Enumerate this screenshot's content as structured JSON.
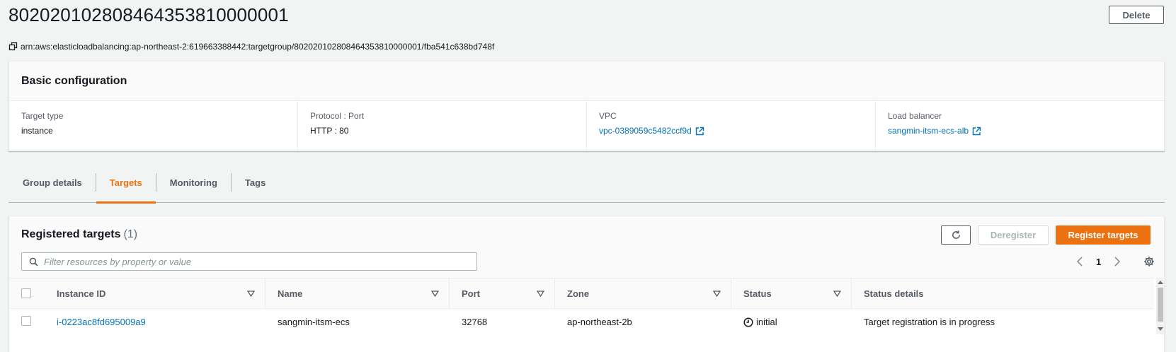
{
  "header": {
    "title": "802020102808464353810000001",
    "delete_label": "Delete",
    "arn": "arn:aws:elasticloadbalancing:ap-northeast-2:619663388442:targetgroup/802020102808464353810000001/fba541c638bd748f"
  },
  "basic_config": {
    "title": "Basic configuration",
    "fields": [
      {
        "label": "Target type",
        "value": "instance"
      },
      {
        "label": "Protocol : Port",
        "value": "HTTP : 80"
      },
      {
        "label": "VPC",
        "value": "vpc-0389059c5482ccf9d"
      },
      {
        "label": "Load balancer",
        "value": "sangmin-itsm-ecs-alb"
      }
    ]
  },
  "tabs": [
    {
      "label": "Group details",
      "active": false
    },
    {
      "label": "Targets",
      "active": true
    },
    {
      "label": "Monitoring",
      "active": false
    },
    {
      "label": "Tags",
      "active": false
    }
  ],
  "targets": {
    "title": "Registered targets",
    "count": "(1)",
    "deregister_label": "Deregister",
    "register_label": "Register targets",
    "search_placeholder": "Filter resources by property or value",
    "page": "1",
    "columns": [
      "Instance ID",
      "Name",
      "Port",
      "Zone",
      "Status",
      "Status details"
    ],
    "rows": [
      {
        "instance_id": "i-0223ac8fd695009a9",
        "name": "sangmin-itsm-ecs",
        "port": "32768",
        "zone": "ap-northeast-2b",
        "status": "initial",
        "status_details": "Target registration is in progress"
      }
    ]
  },
  "icons": {
    "copy": "copy-icon",
    "external": "external-link-icon",
    "refresh": "refresh-icon",
    "search": "search-icon",
    "settings": "gear-icon",
    "status": "clock-icon"
  },
  "colors": {
    "accent": "#ec7211",
    "link": "#0073bb",
    "text": "#16191f",
    "muted": "#545b64"
  }
}
